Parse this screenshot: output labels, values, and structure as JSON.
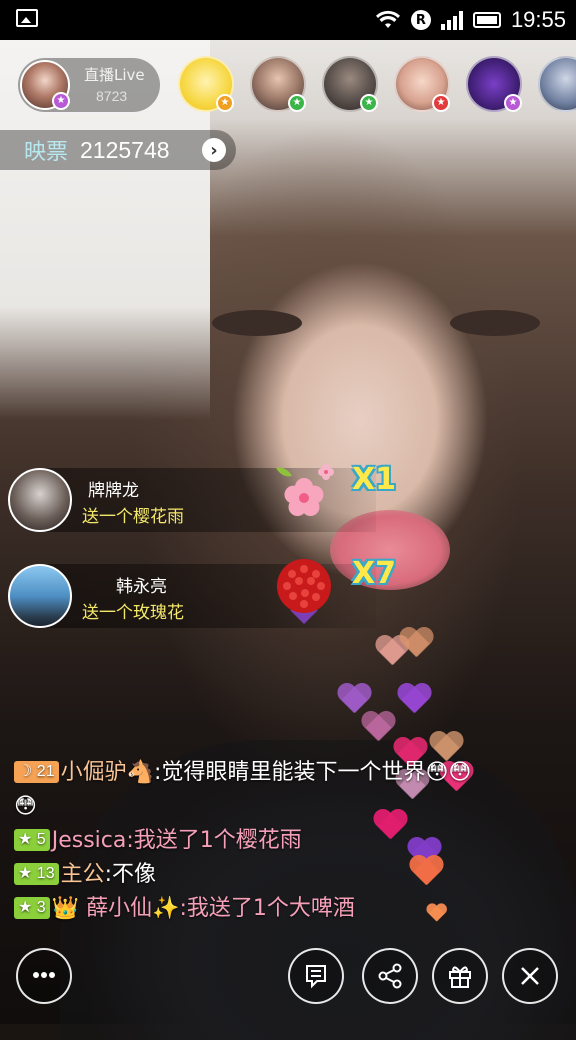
{
  "status_bar": {
    "time": "19:55",
    "icons": [
      "image-notification-icon",
      "wifi-icon",
      "r-badge-icon",
      "signal-icon",
      "battery-icon"
    ],
    "r_badge": "R"
  },
  "host": {
    "title": "直播Live",
    "count": "8723"
  },
  "viewers": [
    {
      "name": "viewer-avatar-1",
      "badge_color": "#f0a020"
    },
    {
      "name": "viewer-avatar-2",
      "badge_color": "#3bb54a"
    },
    {
      "name": "viewer-avatar-3",
      "badge_color": "#3bb54a"
    },
    {
      "name": "viewer-avatar-4",
      "badge_color": "#e03c3c"
    },
    {
      "name": "viewer-avatar-5",
      "badge_color": "#b85ad6"
    }
  ],
  "tickets": {
    "label": "映票",
    "value": "2125748",
    "arrow": "›"
  },
  "gift_notices": [
    {
      "sender": "牌牌龙",
      "action": "送一个樱花雨",
      "multiplier": "X1",
      "gift_icon": "cherry-blossom-icon"
    },
    {
      "sender": "韩永亮",
      "action": "送一个玫瑰花",
      "multiplier": "X7",
      "gift_icon": "rose-bouquet-icon"
    }
  ],
  "chat": [
    {
      "level": "21",
      "level_type": "moon",
      "user": "小倔驴",
      "emoji": "🐴",
      "sep": ":",
      "text": "觉得眼睛里能装下一个世界😳😳😳",
      "gift": false
    },
    {
      "level": "5",
      "level_type": "star",
      "user": "Jessica",
      "emoji": "",
      "sep": ":",
      "text": "我送了1个樱花雨",
      "gift": true
    },
    {
      "level": "13",
      "level_type": "star",
      "user": "主公",
      "emoji": "",
      "sep": ":",
      "text": "不像",
      "gift": false
    },
    {
      "level": "3",
      "level_type": "star",
      "user": "👑 薛小仙✨",
      "emoji": "",
      "sep": ":",
      "text": "我送了1个大啤酒",
      "gift": true
    }
  ],
  "bottom_bar": {
    "buttons": [
      "chat-bubble",
      "private-message",
      "share",
      "gift",
      "close"
    ]
  },
  "colors": {
    "level_moon": "#f5a254",
    "level_star": "#8bcf3a",
    "gift_action": "#f4e86a",
    "multiplier": "#ffe94a",
    "ticket_label": "#b7e8ef"
  }
}
